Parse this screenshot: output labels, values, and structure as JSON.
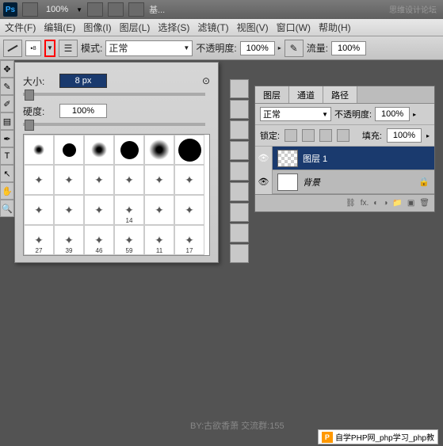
{
  "app": {
    "logo": "Ps",
    "zoom": "100%",
    "doc_label": "基...",
    "watermark": "思维设计论坛"
  },
  "menu": {
    "file": "文件(F)",
    "edit": "编辑(E)",
    "image": "图像(I)",
    "layer": "图层(L)",
    "select": "选择(S)",
    "filter": "滤镜(T)",
    "view": "视图(V)",
    "window": "窗口(W)",
    "help": "帮助(H)"
  },
  "options": {
    "brush_size": "8",
    "mode_label": "模式:",
    "mode_value": "正常",
    "opacity_label": "不透明度:",
    "opacity_value": "100%",
    "flow_label": "流量:",
    "flow_value": "100%"
  },
  "brush_panel": {
    "size_label": "大小:",
    "size_value": "8 px",
    "hardness_label": "硬度:",
    "hardness_value": "100%",
    "presets": [
      {
        "v": "",
        "t": "soft"
      },
      {
        "v": "",
        "t": "hard"
      },
      {
        "v": "",
        "t": "soft"
      },
      {
        "v": "",
        "t": "hard"
      },
      {
        "v": "",
        "t": "soft"
      },
      {
        "v": "",
        "t": "hard"
      },
      {
        "v": "",
        "t": ""
      },
      {
        "v": "",
        "t": ""
      },
      {
        "v": "",
        "t": ""
      },
      {
        "v": "",
        "t": ""
      },
      {
        "v": "",
        "t": ""
      },
      {
        "v": "",
        "t": ""
      },
      {
        "v": "",
        "t": ""
      },
      {
        "v": "",
        "t": ""
      },
      {
        "v": "",
        "t": ""
      },
      {
        "v": "14",
        "t": ""
      },
      {
        "v": "",
        "t": ""
      },
      {
        "v": "",
        "t": ""
      },
      {
        "v": "27",
        "t": ""
      },
      {
        "v": "39",
        "t": ""
      },
      {
        "v": "46",
        "t": ""
      },
      {
        "v": "59",
        "t": ""
      },
      {
        "v": "11",
        "t": ""
      },
      {
        "v": "17",
        "t": ""
      }
    ]
  },
  "layers_panel": {
    "tabs": {
      "layers": "图层",
      "channels": "通道",
      "paths": "路径"
    },
    "blend_mode": "正常",
    "opacity_label": "不透明度:",
    "opacity_value": "100%",
    "lock_label": "锁定:",
    "fill_label": "填充:",
    "fill_value": "100%",
    "items": [
      {
        "name": "图层 1",
        "visible": true,
        "selected": true,
        "thumb": "checker"
      },
      {
        "name": "背景",
        "visible": true,
        "selected": false,
        "thumb": "white",
        "locked": true
      }
    ],
    "fx_label": "fx."
  },
  "footer": {
    "credit": "BY:古欲香萧   交流群:155",
    "badge": "自学PHP网_php学习_php教"
  }
}
